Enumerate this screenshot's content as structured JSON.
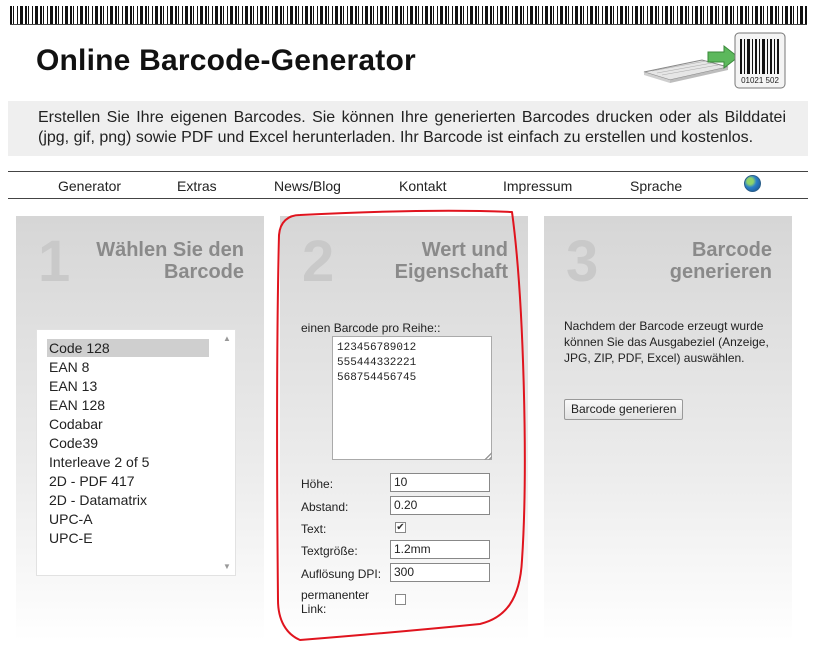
{
  "header": {
    "title": "Online Barcode-Generator",
    "intro": "Erstellen Sie Ihre eigenen Barcodes. Sie können Ihre generierten Barcodes drucken oder als Bilddatei (jpg, gif, png) sowie PDF und Excel herunterladen. Ihr Barcode ist einfach zu erstellen und kostenlos.",
    "logo_code": "01021 502"
  },
  "nav": {
    "items": [
      "Generator",
      "Extras",
      "News/Blog",
      "Kontakt",
      "Impressum",
      "Sprache"
    ],
    "globe_icon": "globe-icon"
  },
  "step1": {
    "number": "1",
    "heading": "Wählen Sie den Barcode",
    "barcode_types": [
      "Code 128",
      "EAN 8",
      "EAN 13",
      "EAN 128",
      "Codabar",
      "Code39",
      "Interleave 2 of 5",
      "2D - PDF 417",
      "2D - Datamatrix",
      "UPC-A",
      "UPC-E"
    ],
    "selected": "Code 128"
  },
  "step2": {
    "number": "2",
    "heading": "Wert und Eigenschaft",
    "values_label": "einen Barcode pro Reihe::",
    "values": "123456789012\n555444332221\n568754456745",
    "hoehe_label": "Höhe:",
    "hoehe_value": "10",
    "abstand_label": "Abstand:",
    "abstand_value": "0.20",
    "text_label": "Text:",
    "text_checked": true,
    "textgroesse_label": "Textgröße:",
    "textgroesse_value": "1.2mm",
    "dpi_label": "Auflösung DPI:",
    "dpi_value": "300",
    "permalink_label_1": "permanenter",
    "permalink_label_2": "Link:",
    "permalink_checked": false
  },
  "step3": {
    "number": "3",
    "heading": "Barcode generieren",
    "description": "Nachdem der Barcode erzeugt wurde können Sie das Ausgabeziel (Anzeige, JPG, ZIP, PDF, Excel) auswählen.",
    "button_label": "Barcode generieren"
  },
  "colors": {
    "panel_bg": "#d6d6d6",
    "heading_grey": "#8a8a8a",
    "highlight_red": "#e0141e",
    "logo_arrow_green": "#5cb85c"
  }
}
